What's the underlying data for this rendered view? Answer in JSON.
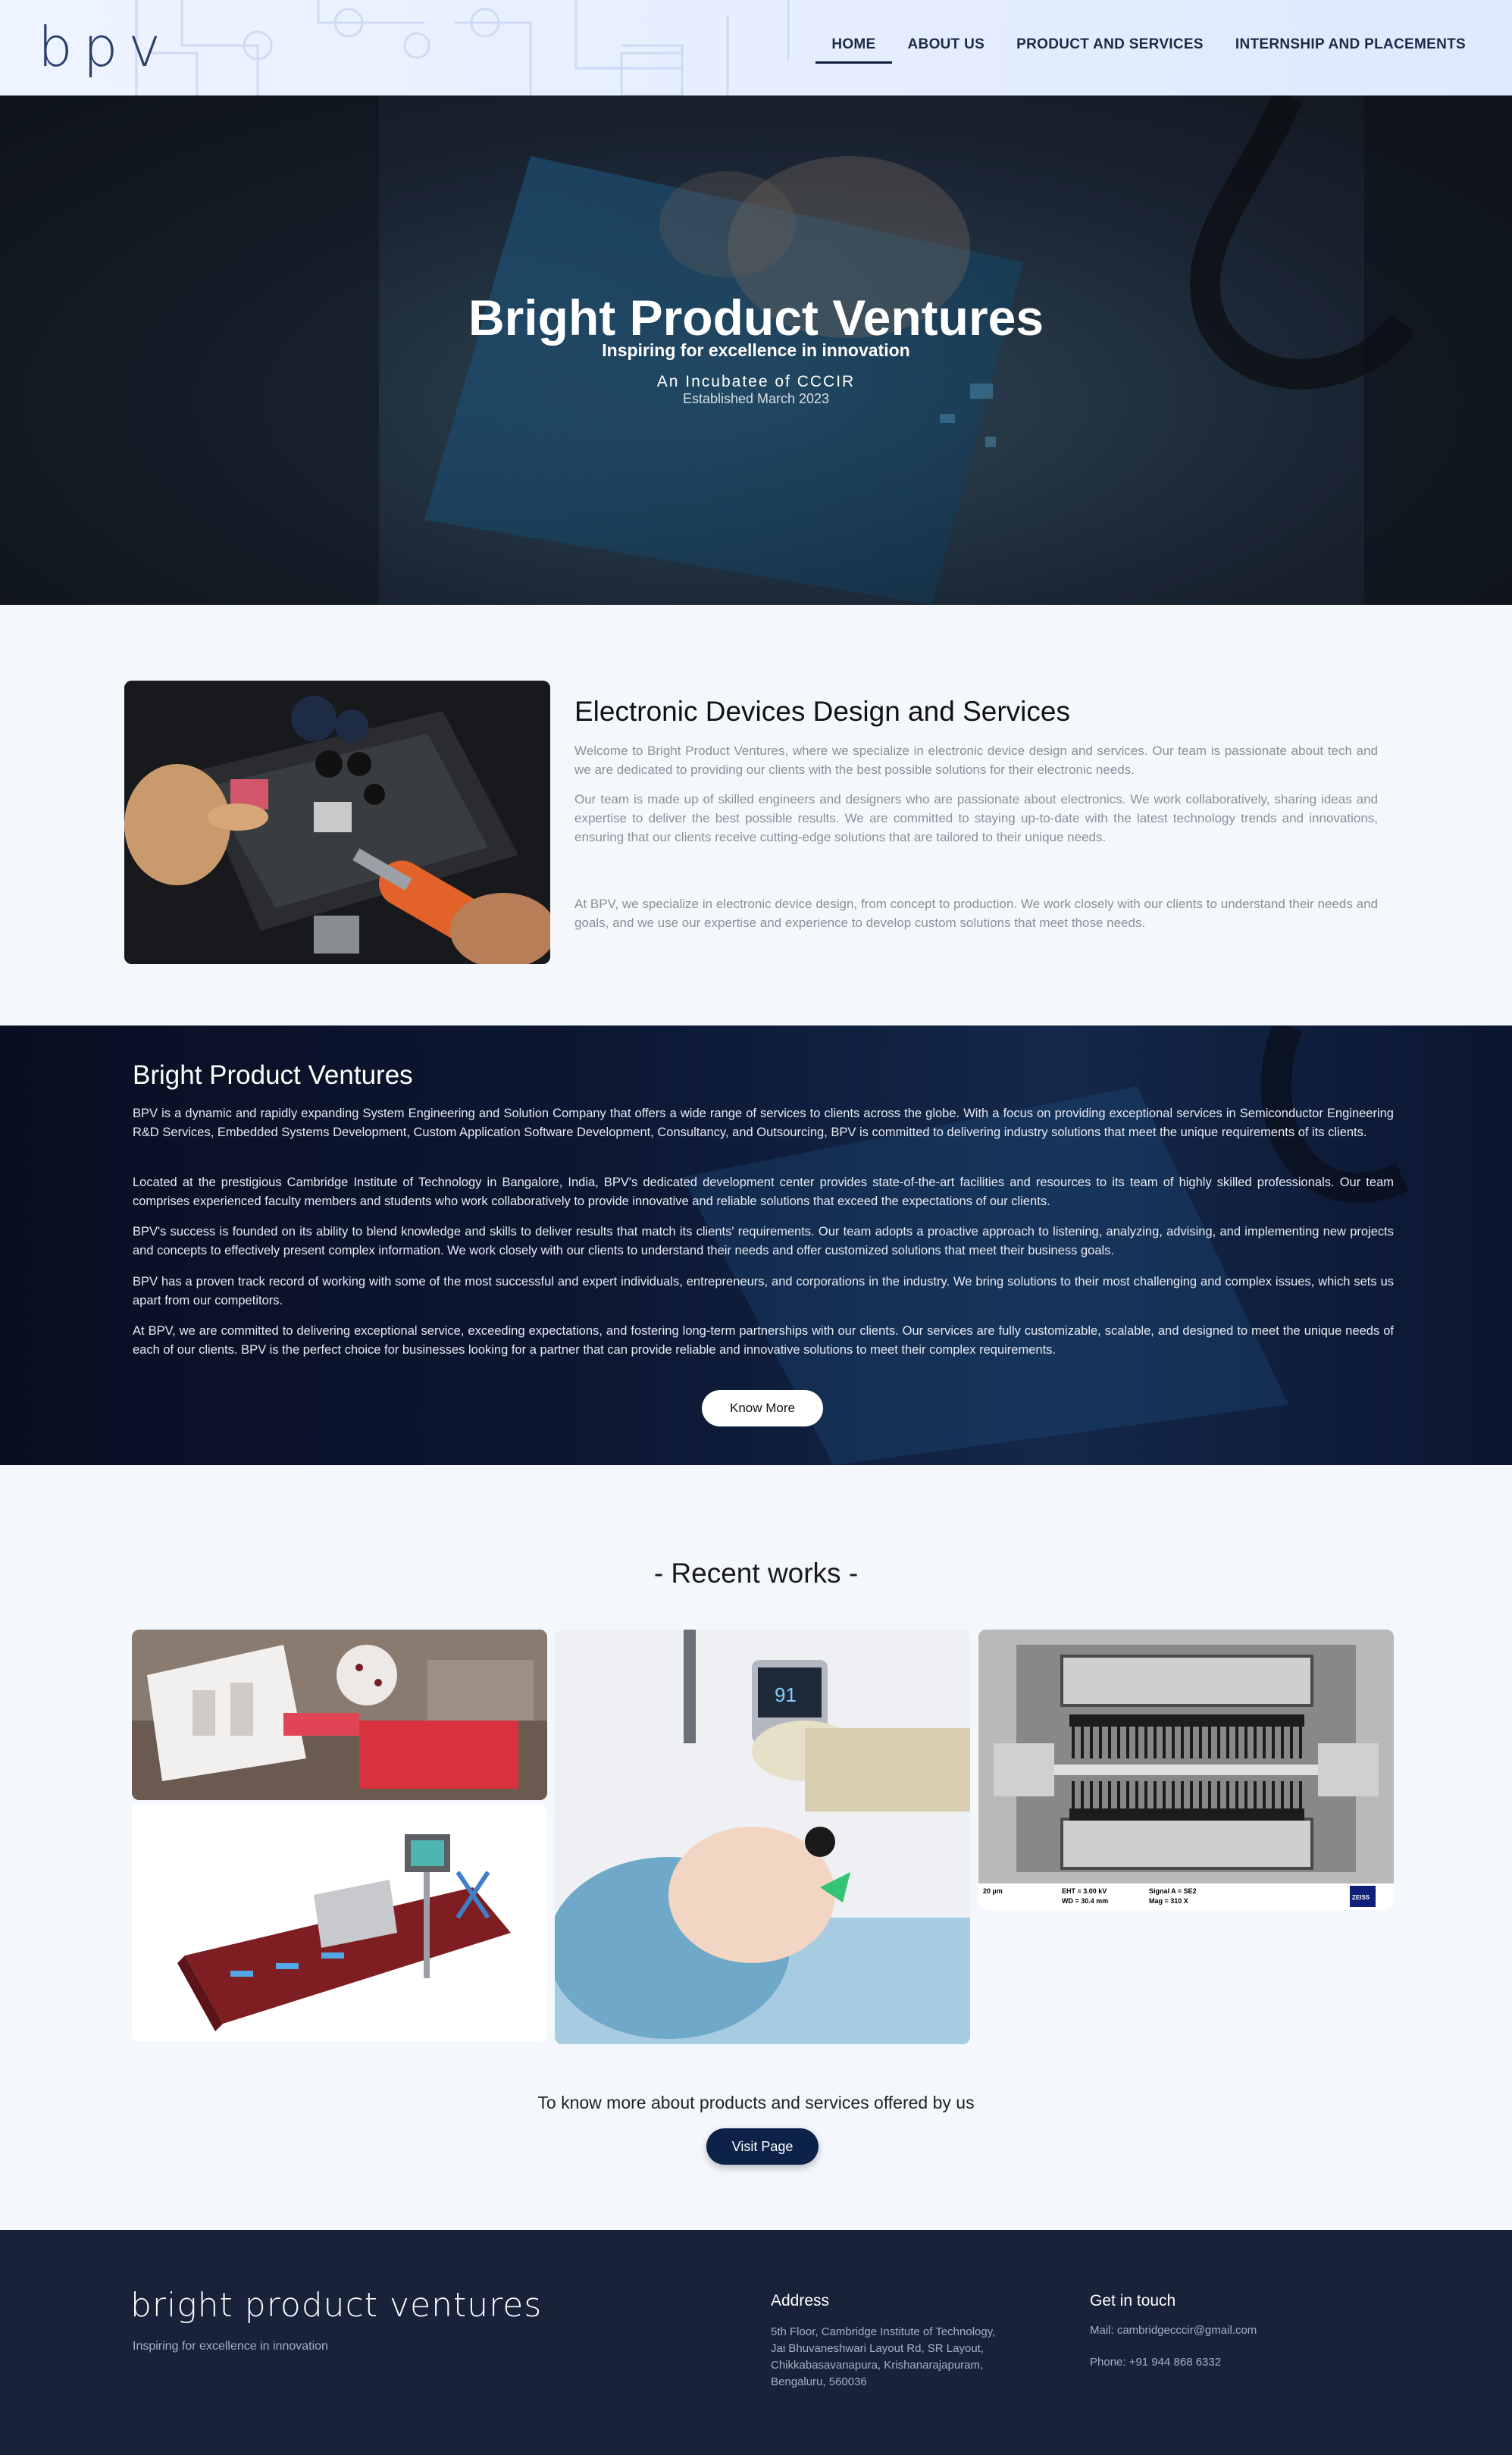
{
  "nav": {
    "logo": "bpv",
    "links": [
      "HOME",
      "ABOUT US",
      "PRODUCT AND SERVICES",
      "INTERNSHIP AND PLACEMENTS"
    ]
  },
  "hero": {
    "title": "Bright Product Ventures",
    "subtitle": "Inspiring for excellence in innovation",
    "incubatee": "An Incubatee of CCCIR",
    "established": "Established March 2023"
  },
  "edd": {
    "title": "Electronic Devices Design and Services",
    "p1": "Welcome to Bright Product Ventures, where we specialize in electronic device design and services. Our team is passionate about tech and we are dedicated to providing our clients with the best possible solutions for their electronic needs.",
    "p2": "Our team is made up of skilled engineers and designers who are passionate about electronics. We work collaboratively, sharing ideas and expertise to deliver the best possible results. We are committed to staying up-to-date with the latest technology trends and innovations, ensuring that our clients receive cutting-edge solutions that are tailored to their unique needs.",
    "p3": "At BPV, we specialize in electronic device design, from concept to production. We work closely with our clients to understand their needs and goals, and we use our expertise and experience to develop custom solutions that meet those needs."
  },
  "about": {
    "title": "Bright Product Ventures",
    "p1": "BPV is a dynamic and rapidly expanding System Engineering and Solution Company that offers a wide range of services to clients across the globe. With a focus on providing exceptional services in Semiconductor Engineering R&D Services, Embedded Systems Development, Custom Application Software Development, Consultancy, and Outsourcing, BPV is committed to delivering industry solutions that meet the unique requirements of its clients.",
    "p2": "Located at the prestigious Cambridge Institute of Technology in Bangalore, India, BPV's dedicated development center provides state-of-the-art facilities and resources to its team of highly skilled professionals. Our team comprises experienced faculty members and students who work collaboratively to provide innovative and reliable solutions that exceed the expectations of our clients.",
    "p3": "BPV's success is founded on its ability to blend knowledge and skills to deliver results that match its clients' requirements. Our team adopts a proactive approach to listening, analyzing, advising, and implementing new projects and concepts to effectively present complex information. We work closely with our clients to understand their needs and offer customized solutions that meet their business goals.",
    "p4": "BPV has a proven track record of working with some of the most successful and expert individuals, entrepreneurs, and corporations in the industry. We bring solutions to their most challenging and complex issues, which sets us apart from our competitors.",
    "p5": "At BPV, we are committed to delivering exceptional service, exceeding expectations, and fostering long-term partnerships with our clients. Our services are fully customizable, scalable, and designed to meet the unique needs of each of our clients. BPV is the perfect choice for businesses looking for a partner that can provide reliable and innovative solutions to meet their complex requirements.",
    "button": "Know More"
  },
  "works": {
    "title": "- Recent works -",
    "sem_line1": "EHT = 3.00 kV",
    "sem_line2": "WD = 30.4 mm",
    "sem_line3": "Signal A = SE2",
    "sem_line4": "Mag = 310 X",
    "sem_scale": "20 µm",
    "sem_brand": "ZEISS",
    "device_reading": "91"
  },
  "cta": {
    "text": "To know more about products and services offered by us",
    "button": "Visit Page"
  },
  "footer": {
    "logo": "bright product ventures",
    "tagline": "Inspiring for excellence in innovation",
    "address_heading": "Address",
    "address_lines": [
      "5th Floor, Cambridge Institute of Technology,",
      "Jai Bhuvaneshwari Layout Rd, SR Layout,",
      "Chikkabasavanapura, Krishanarajapuram,",
      "Bengaluru, 560036"
    ],
    "contact_heading": "Get in touch",
    "mail": "Mail: cambridgecccir@gmail.com",
    "phone": "Phone: +91 944 868 6332"
  }
}
